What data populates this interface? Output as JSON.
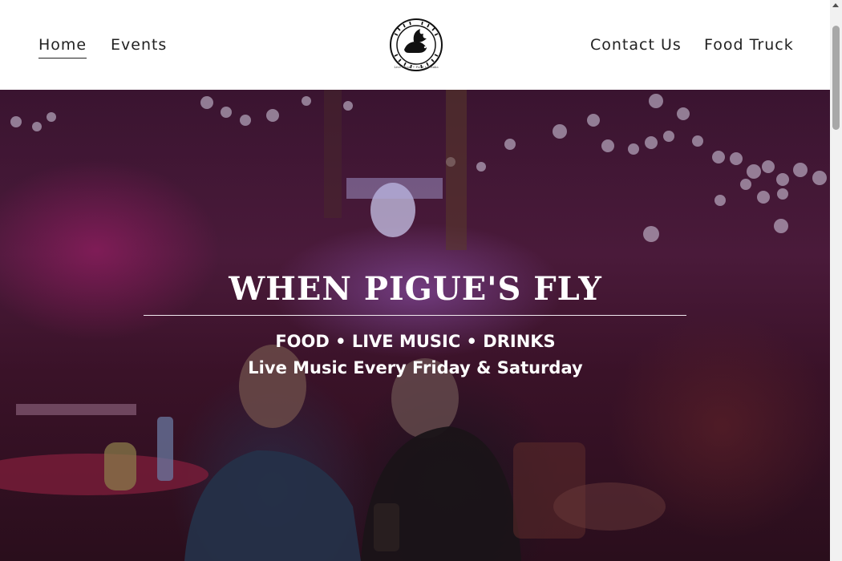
{
  "nav": {
    "home": "Home",
    "events": "Events",
    "contact": "Contact Us",
    "food_truck": "Food Truck"
  },
  "logo": {
    "name": "pigues-fly-logo",
    "tagline": "Live Music • Food • Drinks"
  },
  "hero": {
    "title": "WHEN PIGUE'S FLY",
    "subtitle": "FOOD • LIVE MUSIC • DRINKS",
    "tagline": "Live Music Every Friday & Saturday"
  },
  "colors": {
    "text_dark": "#222222",
    "hero_overlay": "#3a1430",
    "hero_text": "#ffffff"
  }
}
